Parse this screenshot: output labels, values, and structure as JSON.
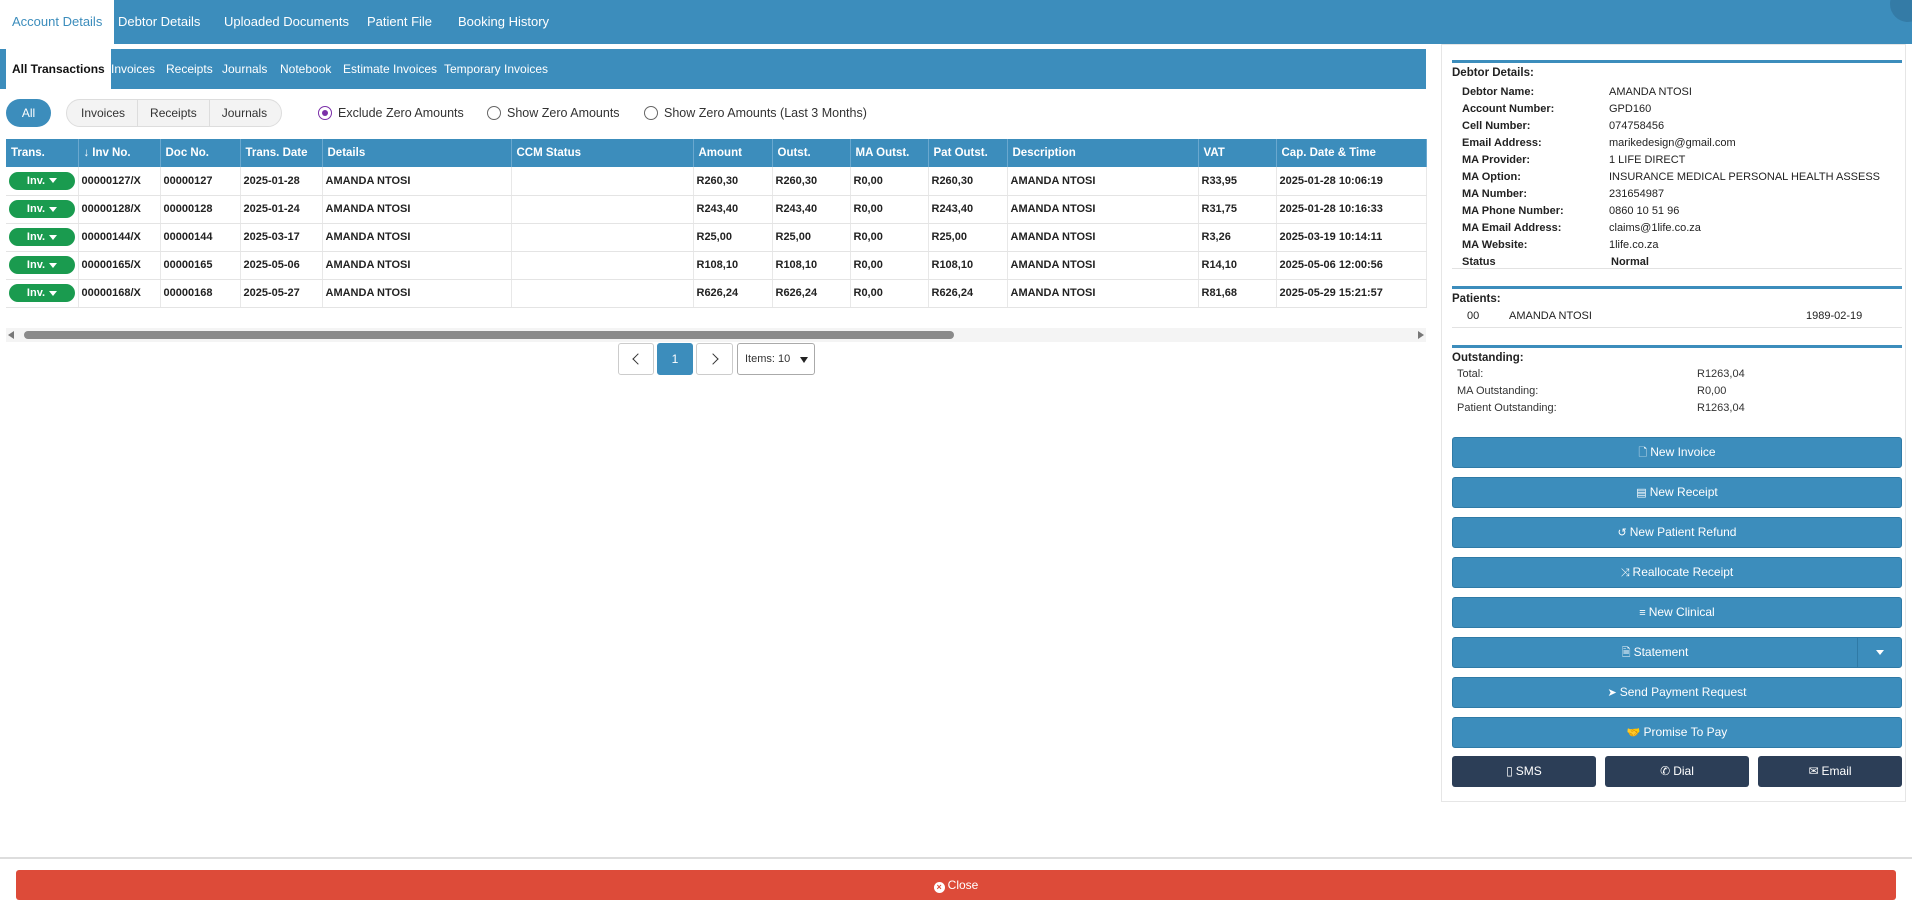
{
  "top_tabs": [
    "Account Details",
    "Debtor Details",
    "Uploaded Documents",
    "Patient File",
    "Booking History"
  ],
  "sub_tabs": [
    "All Transactions",
    "Invoices",
    "Receipts",
    "Journals",
    "Notebook",
    "Estimate Invoices",
    "Temporary Invoices"
  ],
  "filters": {
    "all_label": "All",
    "group": [
      "Invoices",
      "Receipts",
      "Journals"
    ],
    "radios": [
      {
        "label": "Exclude Zero Amounts",
        "checked": true
      },
      {
        "label": "Show Zero Amounts",
        "checked": false
      },
      {
        "label": "Show Zero Amounts (Last 3 Months)",
        "checked": false
      }
    ]
  },
  "table": {
    "columns": [
      "Trans.",
      "Inv No.",
      "Doc No.",
      "Trans. Date",
      "Details",
      "CCM Status",
      "Amount",
      "Outst.",
      "MA Outst.",
      "Pat Outst.",
      "Description",
      "VAT",
      "Cap. Date & Time"
    ],
    "trans_button_label": "Inv.",
    "rows": [
      [
        "00000127/X",
        "00000127",
        "2025-01-28",
        "AMANDA NTOSI",
        "",
        "R260,30",
        "R260,30",
        "R0,00",
        "R260,30",
        "AMANDA NTOSI",
        "R33,95",
        "2025-01-28 10:06:19"
      ],
      [
        "00000128/X",
        "00000128",
        "2025-01-24",
        "AMANDA NTOSI",
        "",
        "R243,40",
        "R243,40",
        "R0,00",
        "R243,40",
        "AMANDA NTOSI",
        "R31,75",
        "2025-01-28 10:16:33"
      ],
      [
        "00000144/X",
        "00000144",
        "2025-03-17",
        "AMANDA NTOSI",
        "",
        "R25,00",
        "R25,00",
        "R0,00",
        "R25,00",
        "AMANDA NTOSI",
        "R3,26",
        "2025-03-19 10:14:11"
      ],
      [
        "00000165/X",
        "00000165",
        "2025-05-06",
        "AMANDA NTOSI",
        "",
        "R108,10",
        "R108,10",
        "R0,00",
        "R108,10",
        "AMANDA NTOSI",
        "R14,10",
        "2025-05-06 12:00:56"
      ],
      [
        "00000168/X",
        "00000168",
        "2025-05-27",
        "AMANDA NTOSI",
        "",
        "R626,24",
        "R626,24",
        "R0,00",
        "R626,24",
        "AMANDA NTOSI",
        "R81,68",
        "2025-05-29 15:21:57"
      ]
    ]
  },
  "pager": {
    "current_page": "1",
    "items_label": "Items: 10"
  },
  "debtor": {
    "title": "Debtor Details:",
    "fields": [
      {
        "label": "Debtor Name:",
        "value": "AMANDA NTOSI"
      },
      {
        "label": "Account Number:",
        "value": "GPD160"
      },
      {
        "label": "Cell Number:",
        "value": "074758456"
      },
      {
        "label": "Email Address:",
        "value": "marikedesign@gmail.com"
      },
      {
        "label": "MA Provider:",
        "value": "1 LIFE DIRECT"
      },
      {
        "label": "MA Option:",
        "value": "INSURANCE MEDICAL PERSONAL HEALTH ASSESS"
      },
      {
        "label": "MA Number:",
        "value": "231654987"
      },
      {
        "label": "MA Phone Number:",
        "value": "0860 10 51 96"
      },
      {
        "label": "MA Email Address:",
        "value": "claims@1life.co.za"
      },
      {
        "label": "MA Website:",
        "value": "1life.co.za"
      },
      {
        "label": "Status",
        "value": "Normal"
      }
    ]
  },
  "patients": {
    "title": "Patients:",
    "rows": [
      {
        "code": "00",
        "name": "AMANDA NTOSI",
        "dob": "1989-02-19"
      }
    ]
  },
  "outstanding": {
    "title": "Outstanding:",
    "rows": [
      {
        "label": "Total:",
        "value": "R1263,04"
      },
      {
        "label": "MA Outstanding:",
        "value": "R0,00"
      },
      {
        "label": "Patient Outstanding:",
        "value": "R1263,04"
      }
    ]
  },
  "actions": [
    {
      "label": "New Invoice",
      "icon": "file-icon",
      "glyph": "🗋"
    },
    {
      "label": "New Receipt",
      "icon": "receipt-icon",
      "glyph": "▤"
    },
    {
      "label": "New Patient Refund",
      "icon": "undo-icon",
      "glyph": "↺"
    },
    {
      "label": "Reallocate Receipt",
      "icon": "shuffle-icon",
      "glyph": "⤨"
    },
    {
      "label": "New Clinical",
      "icon": "list-icon",
      "glyph": "≡"
    },
    {
      "label": "Statement",
      "icon": "document-icon",
      "glyph": "🗎"
    },
    {
      "label": "Send Payment Request",
      "icon": "paper-plane-icon",
      "glyph": "➤"
    },
    {
      "label": "Promise To Pay",
      "icon": "handshake-icon",
      "glyph": "🤝"
    }
  ],
  "contact_buttons": [
    {
      "label": "SMS",
      "icon": "mobile-icon",
      "glyph": "▯"
    },
    {
      "label": "Dial",
      "icon": "phone-icon",
      "glyph": "✆"
    },
    {
      "label": "Email",
      "icon": "envelope-icon",
      "glyph": "✉"
    }
  ],
  "close_label": "Close",
  "colors": {
    "primary": "#3c8dbc",
    "success": "#1a9b4f",
    "danger": "#dd4b39",
    "dark": "#2c3e57"
  }
}
